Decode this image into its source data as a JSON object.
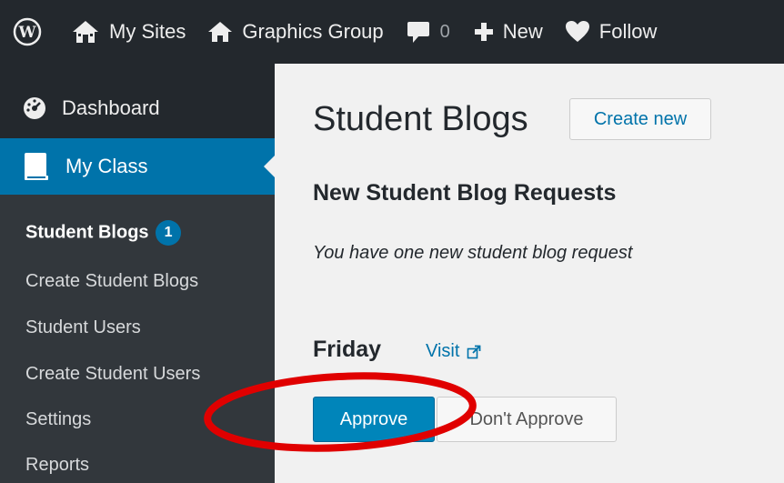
{
  "adminbar": {
    "my_sites": "My Sites",
    "site_name": "Graphics Group",
    "comments_count": "0",
    "new_label": "New",
    "follow_label": "Follow"
  },
  "sidebar": {
    "dashboard": "Dashboard",
    "my_class": "My Class",
    "submenu": [
      {
        "label": "Student Blogs",
        "badge": "1"
      },
      {
        "label": "Create Student Blogs"
      },
      {
        "label": "Student Users"
      },
      {
        "label": "Create Student Users"
      },
      {
        "label": "Settings"
      },
      {
        "label": "Reports"
      }
    ]
  },
  "main": {
    "title": "Student Blogs",
    "create_new": "Create new",
    "section_title": "New Student Blog Requests",
    "notice": "You have one new student blog request",
    "request": {
      "blog_name": "Friday",
      "visit_label": "Visit",
      "approve_label": "Approve",
      "dont_approve_label": "Don't Approve"
    }
  },
  "colors": {
    "adminbar_bg": "#23282d",
    "active_menu": "#0073aa",
    "primary_button": "#0085ba",
    "annotation": "#e00000"
  }
}
